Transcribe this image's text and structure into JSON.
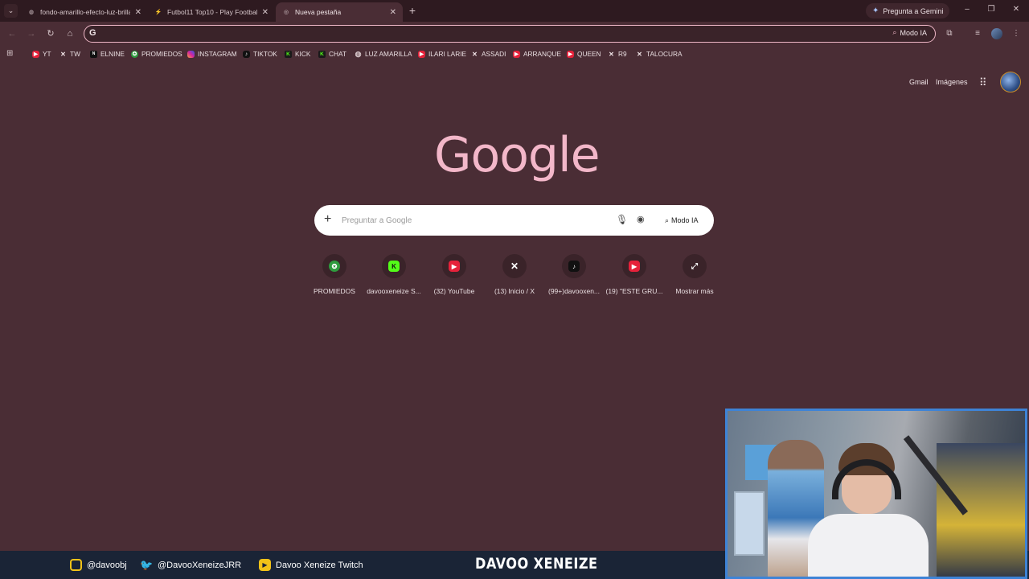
{
  "tabs": [
    {
      "title": "fondo-amarillo-efecto-luz-brillante",
      "active": false
    },
    {
      "title": "Futbol11 Top10 - Play Football",
      "active": false
    },
    {
      "title": "Nueva pestaña",
      "active": true
    }
  ],
  "gemini": {
    "label": "Pregunta a Gemini"
  },
  "omnibox": {
    "value": "",
    "modo_label": "Modo IA"
  },
  "bookmarks": [
    {
      "label": "YT",
      "icon": "youtube-icon"
    },
    {
      "label": "TW",
      "icon": "x-icon"
    },
    {
      "label": "ELNINE",
      "icon": "elnine-icon"
    },
    {
      "label": "PROMIEDOS",
      "icon": "promiedos-icon"
    },
    {
      "label": "INSTAGRAM",
      "icon": "instagram-icon"
    },
    {
      "label": "TIKTOK",
      "icon": "tiktok-icon"
    },
    {
      "label": "KICK",
      "icon": "kick-icon"
    },
    {
      "label": "CHAT",
      "icon": "kick-icon"
    },
    {
      "label": "LUZ AMARILLA",
      "icon": "globe-icon"
    },
    {
      "label": "ILARI LARIE",
      "icon": "youtube-icon"
    },
    {
      "label": "ASSADI",
      "icon": "x-icon"
    },
    {
      "label": "ARRANQUE",
      "icon": "youtube-icon"
    },
    {
      "label": "QUEEN",
      "icon": "youtube-icon"
    },
    {
      "label": "R9",
      "icon": "x-icon"
    },
    {
      "label": "TALOCURA",
      "icon": "x-icon"
    }
  ],
  "header": {
    "gmail": "Gmail",
    "images": "Imágenes"
  },
  "logo": {
    "text": "Google"
  },
  "search": {
    "placeholder": "Preguntar a Google",
    "modo_label": "Modo IA"
  },
  "shortcuts": [
    {
      "label": "PROMIEDOS",
      "icon": "promiedos-icon"
    },
    {
      "label": "davooxeneize S...",
      "icon": "kick-icon"
    },
    {
      "label": "(32) YouTube",
      "icon": "youtube-icon"
    },
    {
      "label": "(13) Inicio / X",
      "icon": "x-icon"
    },
    {
      "label": "(99+)davooxen...",
      "icon": "tiktok-icon"
    },
    {
      "label": "(19) \"ESTE GRU...",
      "icon": "youtube-icon"
    },
    {
      "label": "Mostrar más",
      "icon": "expand-icon"
    }
  ],
  "overlay": {
    "instagram": "@davoobj",
    "twitter": "@DavooXeneizeJRR",
    "twitch": "Davoo Xeneize Twitch",
    "brand": "DAVOO XENEIZE"
  },
  "colors": {
    "background": "#4a2d35",
    "accent": "#f3b7c9",
    "banner": "#1a2436",
    "webcam_border": "#3e83d6"
  }
}
